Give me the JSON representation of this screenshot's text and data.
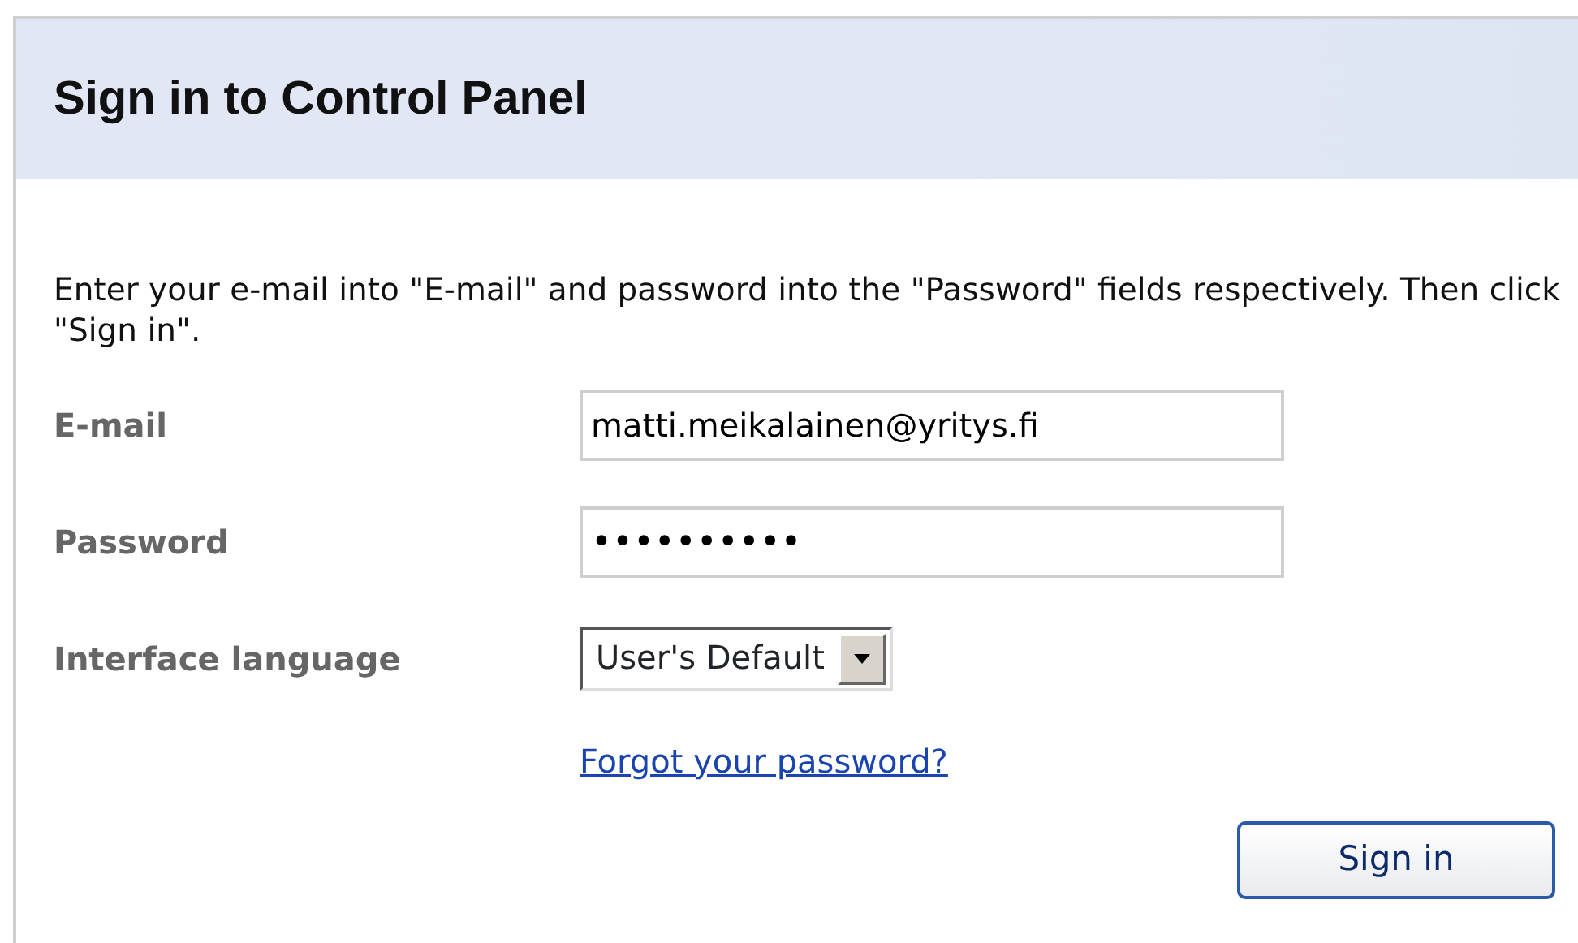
{
  "panel": {
    "title": "Sign in to Control Panel",
    "instructions": "Enter your e-mail into \"E-mail\" and password into the \"Password\" fields respectively. Then click \"Sign in\"."
  },
  "fields": [
    {
      "kind": "text",
      "label": "E-mail",
      "value": "matti.meikalainen@yritys.fi"
    },
    {
      "kind": "password",
      "label": "Password",
      "value": "••••••••••"
    },
    {
      "kind": "select",
      "label": "Interface language",
      "value": "User's Default"
    }
  ],
  "forgot_link": "Forgot your password?",
  "submit_button": "Sign in"
}
